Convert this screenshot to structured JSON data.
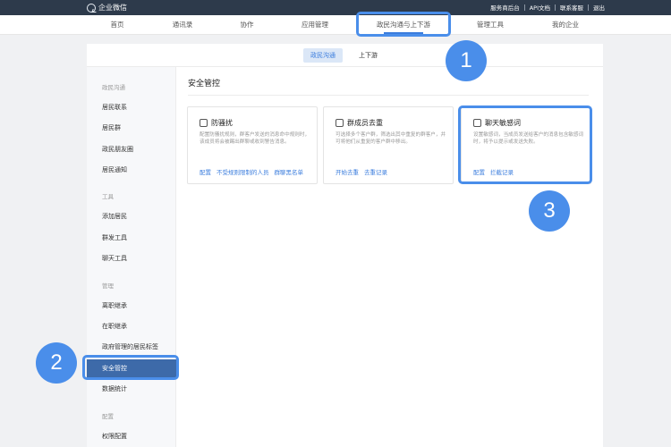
{
  "topbar": {
    "logo_text": "企业微信",
    "links": [
      "服务商后台",
      "API文档",
      "联系客服",
      "退出"
    ]
  },
  "navbar": {
    "items": [
      "首页",
      "通讯录",
      "协作",
      "应用管理",
      "政民沟通与上下游",
      "管理工具",
      "我的企业"
    ],
    "active_index": 4
  },
  "subtabs": {
    "items": [
      "政民沟通",
      "上下游"
    ],
    "active_index": 0
  },
  "sidebar": {
    "groups": [
      {
        "title": "政民沟通",
        "items": [
          "居民联系",
          "居民群",
          "政民朋友圈",
          "居民通知"
        ]
      },
      {
        "title": "工具",
        "items": [
          "添加居民",
          "群发工具",
          "聊天工具"
        ]
      },
      {
        "title": "管理",
        "items": [
          "离职继承",
          "在职继承",
          "政府管理的居民标签",
          "安全管控",
          "数据统计"
        ]
      },
      {
        "title": "配置",
        "items": [
          "权限配置"
        ]
      }
    ],
    "active_item": "安全管控"
  },
  "main": {
    "title": "安全管控",
    "cards": [
      {
        "icon": "shield-icon",
        "title": "防骚扰",
        "desc": "配置防骚扰规则，群客户发送的消息命中规则时，该成员将会被踢出群聊或收到警告消息。",
        "links": [
          "配置",
          "不受规则限制的人员",
          "群聊黑名单"
        ]
      },
      {
        "icon": "group-dedupe-icon",
        "title": "群成员去重",
        "desc": "可选择多个客户群，筛选出其中重复的群客户，并可将他们从重复的客户群中移出。",
        "links": [
          "开始去重",
          "去重记录"
        ]
      },
      {
        "icon": "sensitive-word-icon",
        "title": "聊天敏感词",
        "desc": "设置敏感词，当成员发送给客户的消息包含敏感词时，将予以提示或发送失败。",
        "links": [
          "配置",
          "拦截记录"
        ]
      }
    ]
  },
  "annotations": {
    "badges": [
      "1",
      "2",
      "3"
    ],
    "highlight_color": "#4a8eea"
  },
  "colors": {
    "topbar": "#2d3a4b",
    "accent": "#3b7ddd",
    "sidebar_active": "#3d6aa9"
  }
}
